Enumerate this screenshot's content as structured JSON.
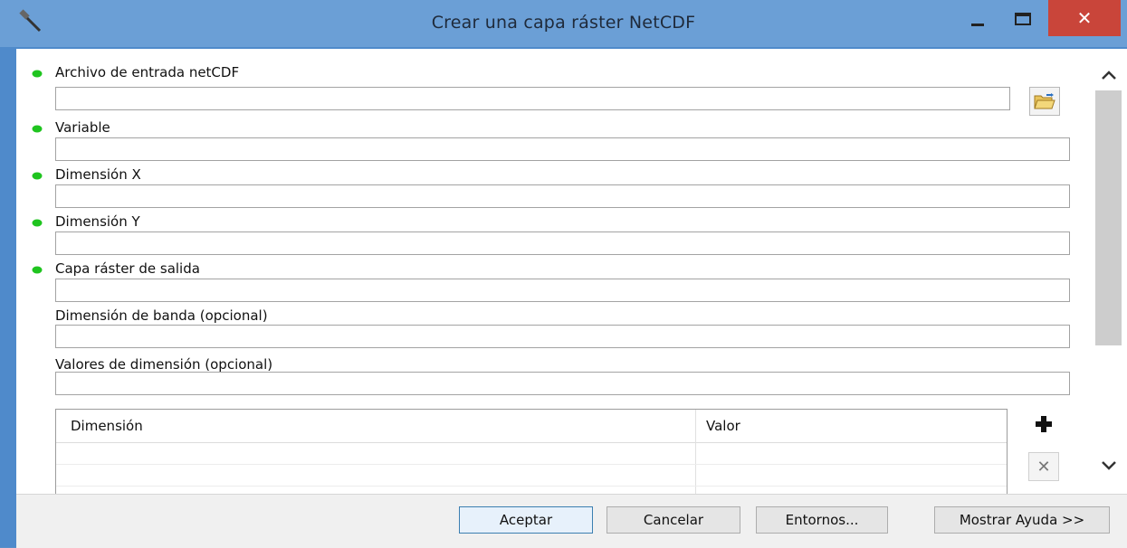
{
  "window": {
    "title": "Crear una capa ráster NetCDF",
    "close_glyph": "✕"
  },
  "fields": [
    {
      "label": "Archivo de entrada netCDF",
      "required": true,
      "value": ""
    },
    {
      "label": "Variable",
      "required": true,
      "value": ""
    },
    {
      "label": "Dimensión X",
      "required": true,
      "value": ""
    },
    {
      "label": "Dimensión Y",
      "required": true,
      "value": ""
    },
    {
      "label": "Capa ráster de salida",
      "required": true,
      "value": ""
    },
    {
      "label": "Dimensión de banda (opcional)",
      "required": false,
      "value": ""
    },
    {
      "label": "Valores de dimensión (opcional)",
      "required": false,
      "value": ""
    }
  ],
  "table": {
    "columns": [
      "Dimensión",
      "Valor"
    ],
    "delete_glyph": "✕"
  },
  "footer": {
    "ok": "Aceptar",
    "cancel": "Cancelar",
    "environments": "Entornos...",
    "show_help": "Mostrar Ayuda >>"
  },
  "icons": {
    "app": "hammer-icon",
    "browse": "folder-open-icon",
    "add": "plus-icon",
    "remove": "x-icon",
    "required": "green-dot-icon"
  },
  "colors": {
    "titlebar": "#6b9fd6",
    "close": "#c9453a",
    "required_dot": "#1fc41f"
  }
}
